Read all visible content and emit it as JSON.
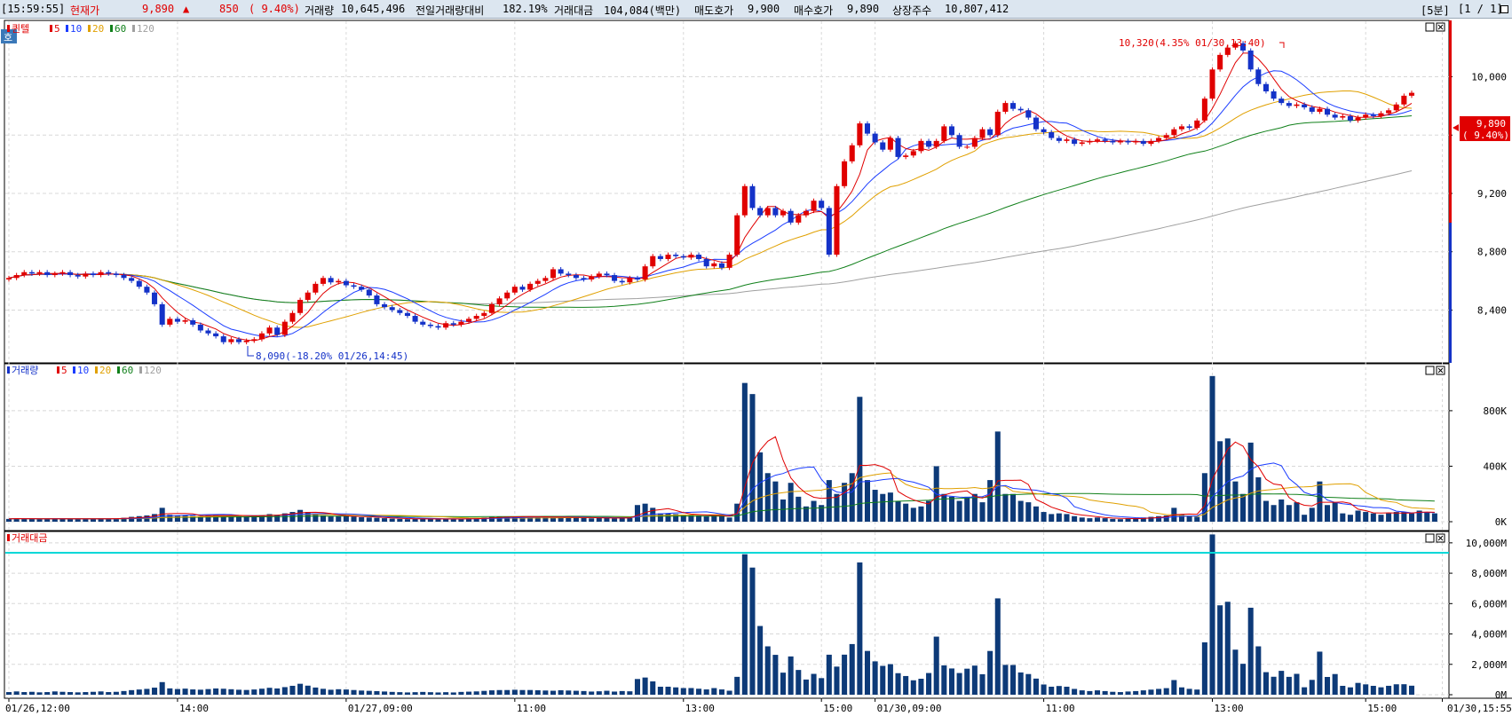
{
  "header": {
    "time": "[15:59:55]",
    "current_price_label": "현재가",
    "current_price": "9,890",
    "change_arrow": "▲",
    "change": "850",
    "change_pct": "( 9.40%)",
    "volume_label": "거래량",
    "volume": "10,645,496",
    "prev_volume_ratio_label": "전일거래량대비",
    "prev_volume_ratio": "182.19%",
    "trade_value_label": "거래대금",
    "trade_value": "104,084(백만)",
    "ask_label": "매도호가",
    "ask": "9,900",
    "bid_label": "매수호가",
    "bid": "9,890",
    "shares_label": "상장주수",
    "shares": "10,807,412",
    "interval": "[5분]",
    "page": "[1 / 1]"
  },
  "panels": {
    "price": {
      "side_button": "호",
      "legend_title": "퀸텔",
      "ma_legend": [
        {
          "label": "5",
          "color": "#e00000"
        },
        {
          "label": "10",
          "color": "#1a3cff"
        },
        {
          "label": "20",
          "color": "#e0a000"
        },
        {
          "label": "60",
          "color": "#10801a"
        },
        {
          "label": "120",
          "color": "#a0a0a0"
        }
      ],
      "y_ticks": [
        "10,000",
        "9,600",
        "9,200",
        "8,800",
        "8,400"
      ],
      "current_tag": "9,890",
      "current_tag_pct": "( 9.40%)",
      "high_annotation": "10,320(4.35% 01/30,13:40)",
      "low_annotation": "8,090(-18.20% 01/26,14:45)"
    },
    "volume": {
      "legend_title": "거래량",
      "ma_legend": [
        {
          "label": "5",
          "color": "#e00000"
        },
        {
          "label": "10",
          "color": "#1a3cff"
        },
        {
          "label": "20",
          "color": "#e0a000"
        },
        {
          "label": "60",
          "color": "#10801a"
        },
        {
          "label": "120",
          "color": "#a0a0a0"
        }
      ],
      "y_ticks": [
        "800K",
        "400K",
        "0K"
      ]
    },
    "value": {
      "legend_title": "거래대금",
      "y_ticks": [
        "10,000M",
        "8,000M",
        "6,000M",
        "4,000M",
        "2,000M",
        "0M"
      ]
    }
  },
  "x_axis": {
    "labels": [
      "01/26,12:00",
      "14:00",
      "01/27,09:00",
      "11:00",
      "13:00",
      "15:00",
      "01/30,09:00",
      "11:00",
      "13:00",
      "15:00",
      "01/30,15:55"
    ]
  },
  "colors": {
    "up": "#e00000",
    "down": "#1432c8",
    "bar": "#0d3a78",
    "header_bg": "#dce6f0",
    "reference_line": "#00d8d8"
  },
  "chart_data": {
    "type": "candlestick",
    "interval": "5분",
    "price_axis": {
      "min": 8050,
      "max": 10350,
      "ticks": [
        8400,
        8800,
        9200,
        9600,
        10000
      ]
    },
    "volume_axis": {
      "ticks_k": [
        0,
        400,
        800
      ]
    },
    "value_axis": {
      "ticks_m": [
        0,
        2000,
        4000,
        6000,
        8000,
        10000
      ],
      "reference_m": 10000
    },
    "current_price": 9890,
    "high": {
      "value": 10320,
      "pct": 4.35,
      "time": "01/30,13:40"
    },
    "low": {
      "value": 8090,
      "pct": -18.2,
      "time": "01/26,14:45"
    },
    "closes": [
      8620,
      8640,
      8660,
      8650,
      8660,
      8640,
      8650,
      8660,
      8640,
      8630,
      8650,
      8640,
      8660,
      8650,
      8640,
      8620,
      8600,
      8560,
      8520,
      8440,
      8300,
      8340,
      8320,
      8330,
      8300,
      8260,
      8240,
      8220,
      8180,
      8200,
      8180,
      8190,
      8200,
      8240,
      8280,
      8230,
      8320,
      8380,
      8470,
      8520,
      8580,
      8620,
      8590,
      8600,
      8570,
      8560,
      8540,
      8500,
      8440,
      8420,
      8400,
      8380,
      8360,
      8320,
      8300,
      8290,
      8280,
      8310,
      8300,
      8320,
      8340,
      8360,
      8380,
      8440,
      8480,
      8520,
      8560,
      8540,
      8580,
      8600,
      8620,
      8680,
      8650,
      8640,
      8620,
      8610,
      8630,
      8650,
      8640,
      8600,
      8590,
      8620,
      8610,
      8700,
      8770,
      8750,
      8780,
      8770,
      8760,
      8780,
      8750,
      8700,
      8720,
      8690,
      8780,
      9050,
      9250,
      9100,
      9050,
      9100,
      9050,
      9080,
      9000,
      9050,
      9080,
      9150,
      9100,
      8780,
      9250,
      9420,
      9530,
      9680,
      9610,
      9550,
      9500,
      9580,
      9450,
      9460,
      9490,
      9560,
      9520,
      9560,
      9660,
      9600,
      9520,
      9520,
      9580,
      9640,
      9600,
      9760,
      9820,
      9780,
      9770,
      9720,
      9640,
      9620,
      9580,
      9560,
      9570,
      9540,
      9550,
      9560,
      9570,
      9560,
      9550,
      9560,
      9550,
      9560,
      9540,
      9560,
      9580,
      9600,
      9640,
      9660,
      9650,
      9700,
      9850,
      10050,
      10150,
      10200,
      10230,
      10180,
      10050,
      9950,
      9900,
      9850,
      9820,
      9800,
      9810,
      9790,
      9760,
      9780,
      9740,
      9720,
      9730,
      9700,
      9720,
      9740,
      9730,
      9750,
      9770,
      9810,
      9870,
      9890
    ],
    "volume_k": [
      20,
      25,
      20,
      22,
      18,
      20,
      25,
      22,
      20,
      18,
      20,
      22,
      25,
      20,
      22,
      28,
      35,
      40,
      45,
      55,
      100,
      50,
      45,
      48,
      42,
      40,
      45,
      50,
      48,
      44,
      40,
      38,
      42,
      48,
      55,
      50,
      60,
      70,
      85,
      70,
      55,
      45,
      38,
      42,
      40,
      36,
      32,
      30,
      28,
      25,
      22,
      20,
      18,
      20,
      22,
      20,
      18,
      20,
      18,
      22,
      24,
      26,
      30,
      34,
      36,
      36,
      38,
      36,
      36,
      34,
      32,
      30,
      34,
      32,
      30,
      28,
      24,
      26,
      30,
      24,
      28,
      26,
      120,
      130,
      100,
      60,
      60,
      55,
      50,
      50,
      45,
      40,
      50,
      40,
      30,
      130,
      1000,
      920,
      500,
      350,
      290,
      160,
      280,
      180,
      110,
      150,
      120,
      300,
      200,
      280,
      350,
      900,
      300,
      230,
      200,
      210,
      150,
      130,
      100,
      110,
      150,
      400,
      200,
      180,
      150,
      180,
      200,
      140,
      300,
      650,
      200,
      200,
      150,
      140,
      110,
      70,
      55,
      60,
      55,
      40,
      30,
      25,
      30,
      25,
      20,
      18,
      22,
      25,
      30,
      35,
      40,
      45,
      100,
      50,
      40,
      35,
      350,
      1050,
      580,
      600,
      290,
      200,
      570,
      320,
      150,
      120,
      160,
      120,
      140,
      50,
      100,
      290,
      120,
      140,
      60,
      50,
      80,
      70,
      60,
      50,
      60,
      70,
      70,
      60,
      80,
      70,
      60
    ],
    "ma_price": {
      "ma5": [
        8620,
        8640,
        8660,
        8650,
        8660,
        8640,
        8650,
        8660,
        8640,
        8630,
        8650,
        8640,
        8660,
        8650,
        8640,
        8620,
        8600,
        8560,
        8520,
        8440,
        8300,
        8340,
        8320,
        8330,
        8300,
        8260,
        8240,
        8220,
        8180,
        8200,
        8180,
        8190,
        8200,
        8240,
        8280,
        8230,
        8320,
        8380,
        8470,
        8520,
        8580,
        8620,
        8590,
        8600,
        8570,
        8560,
        8540,
        8500,
        8440,
        8420,
        8400,
        8380,
        8360,
        8320,
        8300,
        8290,
        8280,
        8310,
        8300,
        8320,
        8340,
        8360,
        8380,
        8440,
        8480,
        8520,
        8560,
        8540,
        8580,
        8600,
        8620,
        8680,
        8650,
        8640,
        8620,
        8610,
        8630,
        8650,
        8640,
        8600,
        8590,
        8620,
        8610,
        8700,
        8770,
        8750,
        8780,
        8770,
        8760,
        8780,
        8750,
        8700,
        8720,
        8690,
        8780,
        9050,
        9250,
        9100,
        9050,
        9100,
        9050,
        9080,
        9000,
        9050,
        9080,
        9150,
        9100,
        8780,
        9250,
        9420,
        9530,
        9680,
        9610,
        9550,
        9500,
        9580,
        9450,
        9460,
        9490,
        9560,
        9520,
        9560,
        9660,
        9600,
        9520,
        9520,
        9580,
        9640,
        9600,
        9760,
        9820,
        9780,
        9770,
        9720,
        9640,
        9620,
        9580,
        9560,
        9570,
        9540,
        9550,
        9560,
        9570,
        9560,
        9550,
        9560,
        9550,
        9560,
        9540,
        9560,
        9580,
        9600,
        9640,
        9660,
        9650,
        9700,
        9850,
        10050,
        10150,
        10200,
        10230,
        10180,
        10050,
        9950,
        9900,
        9850,
        9820,
        9800,
        9810,
        9790,
        9760,
        9780,
        9740,
        9720,
        9730,
        9700,
        9720,
        9740,
        9730,
        9750,
        9770,
        9810,
        9870,
        9890
      ]
    }
  }
}
